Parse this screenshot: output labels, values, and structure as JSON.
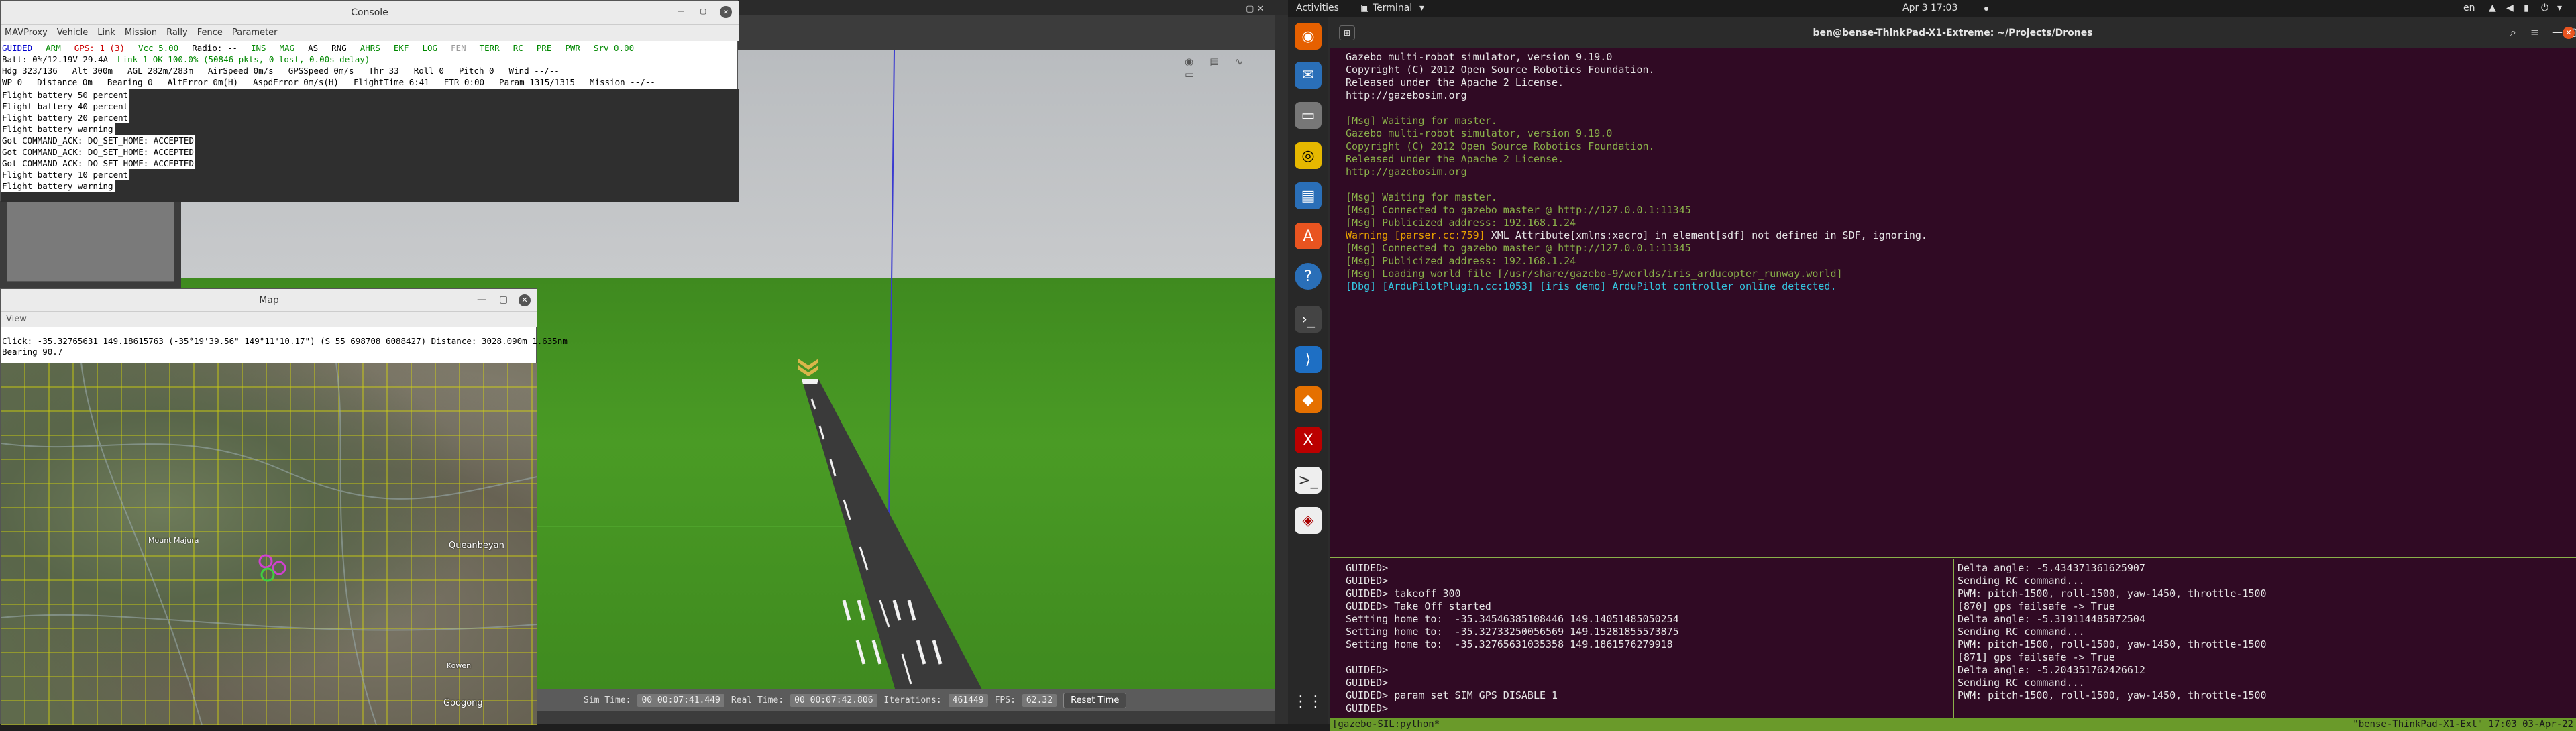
{
  "console": {
    "title": "Console",
    "menu": [
      "MAVProxy",
      "Vehicle",
      "Link",
      "Mission",
      "Rally",
      "Fence",
      "Parameter"
    ],
    "status_row1": [
      {
        "text": "GUIDED",
        "color": "#0000cc"
      },
      {
        "text": "ARM",
        "color": "#008800"
      },
      {
        "text": "GPS: 1 (3)",
        "color": "#cc0000"
      },
      {
        "text": "Vcc 5.00",
        "color": "#008800"
      },
      {
        "text": "Radio: --",
        "color": "#000000"
      },
      {
        "text": "INS",
        "color": "#008800"
      },
      {
        "text": "MAG",
        "color": "#008800"
      },
      {
        "text": "AS",
        "color": "#000000"
      },
      {
        "text": "RNG",
        "color": "#000000"
      },
      {
        "text": "AHRS",
        "color": "#008800"
      },
      {
        "text": "EKF",
        "color": "#008800"
      },
      {
        "text": "LOG",
        "color": "#008800"
      },
      {
        "text": "FEN",
        "color": "#999999"
      },
      {
        "text": "TERR",
        "color": "#008800"
      },
      {
        "text": "RC",
        "color": "#008800"
      },
      {
        "text": "PRE",
        "color": "#008800"
      },
      {
        "text": "PWR",
        "color": "#008800"
      },
      {
        "text": "Srv 0.00",
        "color": "#008800"
      }
    ],
    "status_row2": [
      {
        "text": "Batt: 0%/12.19V 29.4A",
        "color": "#000000"
      },
      {
        "text": "Link 1 OK 100.0% (50846 pkts, 0 lost, 0.00s delay)",
        "color": "#008800"
      }
    ],
    "status_row3": [
      "Hdg 323/136",
      "Alt 300m",
      "AGL 282m/283m",
      "AirSpeed 0m/s",
      "GPSSpeed 0m/s",
      "Thr 33",
      "Roll 0",
      "Pitch 0",
      "Wind --/--"
    ],
    "status_row4": [
      "WP 0",
      "Distance 0m",
      "Bearing 0",
      "AltError 0m(H)",
      "AspdError 0m/s(H)",
      "FlightTime 6:41",
      "ETR 0:00",
      "Param 1315/1315",
      "Mission --/--"
    ],
    "log": [
      "Flight battery 50 percent",
      "Flight battery 40 percent",
      "Flight battery 20 percent",
      "Flight battery warning",
      "Got COMMAND_ACK: DO_SET_HOME: ACCEPTED",
      "Got COMMAND_ACK: DO_SET_HOME: ACCEPTED",
      "Got COMMAND_ACK: DO_SET_HOME: ACCEPTED",
      "Flight battery 10 percent",
      "Flight battery warning"
    ]
  },
  "map": {
    "title": "Map",
    "menu": "View",
    "info1": "Click: -35.32765631 149.18615763 (-35°19'39.56\" 149°11'10.17\") (S 55 698708 6088427)  Distance: 3028.090m 1.635nm",
    "info2": "Bearing 90.7",
    "labels": [
      "Queanbeyan",
      "Googong",
      "Mount Majura",
      "Kowen"
    ]
  },
  "gazebo": {
    "sim_time_label": "Sim Time:",
    "sim_time": "00 00:07:41.449",
    "real_time_label": "Real Time:",
    "real_time": "00 00:07:42.806",
    "iterations_label": "Iterations:",
    "iterations": "461449",
    "fps_label": "FPS:",
    "fps": "62.32",
    "reset_label": "Reset Time"
  },
  "desktop": {
    "activities": "Activities",
    "app_name": "Terminal",
    "clock": "Apr 3  17:03",
    "keyboard": "en"
  },
  "terminal": {
    "title": "ben@bense-ThinkPad-X1-Extreme: ~/Projects/Drones",
    "top_lines": [
      {
        "text": "Gazebo multi-robot simulator, version 9.19.0",
        "color": "#e6e6e6"
      },
      {
        "text": "Copyright (C) 2012 Open Source Robotics Foundation.",
        "color": "#e6e6e6"
      },
      {
        "text": "Released under the Apache 2 License.",
        "color": "#e6e6e6"
      },
      {
        "text": "http://gazebosim.org",
        "color": "#e6e6e6"
      },
      {
        "text": "",
        "color": "#e6e6e6"
      },
      {
        "text": "[Msg] Waiting for master.",
        "color": "#8ab04a"
      },
      {
        "text": "Gazebo multi-robot simulator, version 9.19.0",
        "color": "#8ab04a"
      },
      {
        "text": "Copyright (C) 2012 Open Source Robotics Foundation.",
        "color": "#8ab04a"
      },
      {
        "text": "Released under the Apache 2 License.",
        "color": "#8ab04a"
      },
      {
        "text": "http://gazebosim.org",
        "color": "#8ab04a"
      },
      {
        "text": "",
        "color": "#8ab04a"
      },
      {
        "text": "[Msg] Waiting for master.",
        "color": "#8ab04a"
      },
      {
        "text": "[Msg] Connected to gazebo master @ http://127.0.0.1:11345",
        "color": "#8ab04a"
      },
      {
        "text": "[Msg] Publicized address: 192.168.1.24",
        "color": "#8ab04a"
      },
      {
        "text": "Warning [parser.cc:759] XML Attribute[xmlns:xacro] in element[sdf] not defined in SDF, ignoring.",
        "color": "#e6e6e6",
        "prefix": "Warning [parser.cc:759]",
        "prefix_color": "#e7a000"
      },
      {
        "text": "[Msg] Connected to gazebo master @ http://127.0.0.1:11345",
        "color": "#8ab04a"
      },
      {
        "text": "[Msg] Publicized address: 192.168.1.24",
        "color": "#8ab04a"
      },
      {
        "text": "[Msg] Loading world file [/usr/share/gazebo-9/worlds/iris_arducopter_runway.world]",
        "color": "#8ab04a"
      },
      {
        "text": "[Dbg] [ArduPilotPlugin.cc:1053] [iris_demo] ArduPilot controller online detected.",
        "color": "#34c6e0"
      }
    ],
    "left_pane": [
      "GUIDED>",
      "GUIDED>",
      "GUIDED> takeoff 300",
      "GUIDED> Take Off started",
      "Setting home to:  -35.34546385108446 149.14051485050254",
      "Setting home to:  -35.32733250056569 149.15281855573875",
      "Setting home to:  -35.32765631035358 149.1861576279918",
      "",
      "GUIDED>",
      "GUIDED>",
      "GUIDED> param set SIM_GPS_DISABLE 1",
      "GUIDED> "
    ],
    "right_pane": [
      "Delta angle: -5.434371361625907",
      "Sending RC command...",
      "PWM: pitch-1500, roll-1500, yaw-1450, throttle-1500",
      "[870] gps failsafe -> True",
      "Delta angle: -5.319114485872504",
      "Sending RC command...",
      "PWM: pitch-1500, roll-1500, yaw-1450, throttle-1500",
      "[871] gps failsafe -> True",
      "Delta angle: -5.204351762426612",
      "Sending RC command...",
      "PWM: pitch-1500, roll-1500, yaw-1450, throttle-1500"
    ],
    "status_left": "[gazebo-SIL:python*",
    "status_right": "\"bense-ThinkPad-X1-Ext\" 17:03 03-Apr-22"
  }
}
